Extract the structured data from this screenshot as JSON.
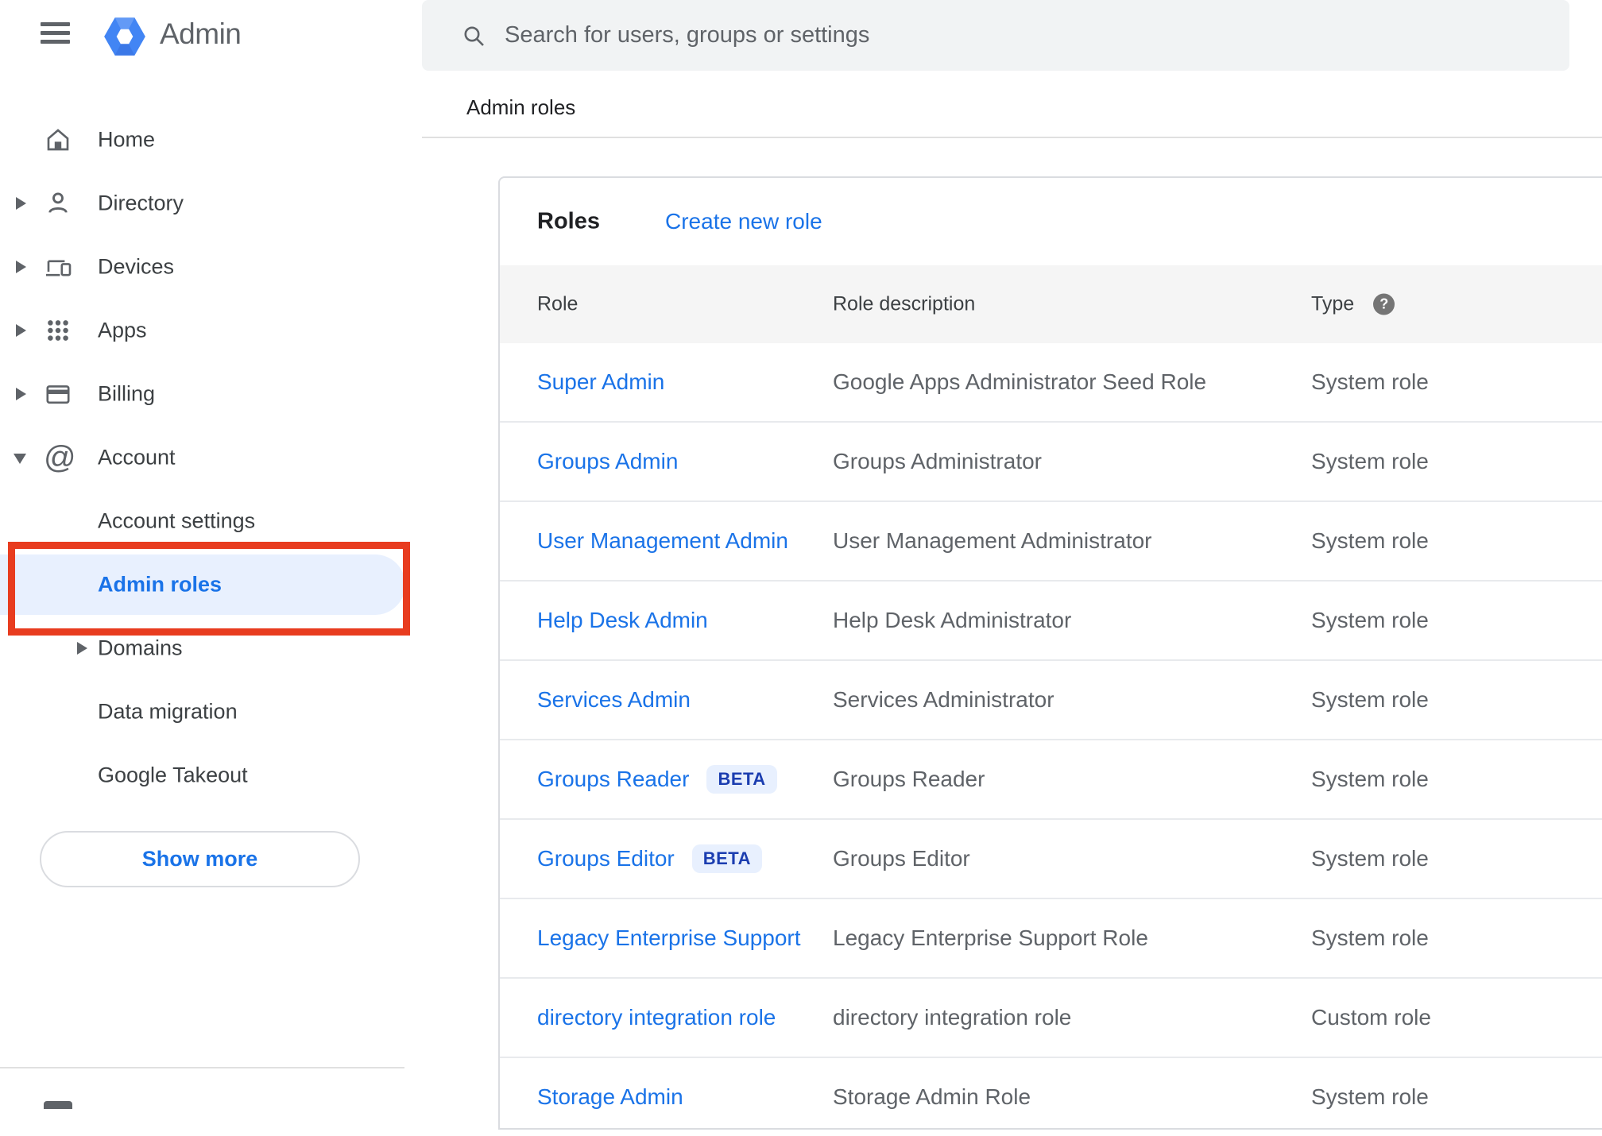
{
  "app": {
    "product_name": "Admin"
  },
  "search": {
    "placeholder": "Search for users, groups or settings"
  },
  "breadcrumb": "Admin roles",
  "sidebar": {
    "items": [
      {
        "label": "Home",
        "icon": "home-icon",
        "caret": "none",
        "indent": false,
        "active": false
      },
      {
        "label": "Directory",
        "icon": "person-icon",
        "caret": "right",
        "indent": false,
        "active": false
      },
      {
        "label": "Devices",
        "icon": "devices-icon",
        "caret": "right",
        "indent": false,
        "active": false
      },
      {
        "label": "Apps",
        "icon": "apps-grid-icon",
        "caret": "right",
        "indent": false,
        "active": false
      },
      {
        "label": "Billing",
        "icon": "credit-card-icon",
        "caret": "right",
        "indent": false,
        "active": false
      },
      {
        "label": "Account",
        "icon": "at-sign-icon",
        "caret": "down",
        "indent": false,
        "active": false
      },
      {
        "label": "Account settings",
        "icon": null,
        "caret": "none",
        "indent": true,
        "active": false
      },
      {
        "label": "Admin roles",
        "icon": null,
        "caret": "none",
        "indent": true,
        "active": true
      },
      {
        "label": "Domains",
        "icon": null,
        "caret": "right",
        "indent": true,
        "active": false
      },
      {
        "label": "Data migration",
        "icon": null,
        "caret": "none",
        "indent": true,
        "active": false
      },
      {
        "label": "Google Takeout",
        "icon": null,
        "caret": "none",
        "indent": true,
        "active": false
      }
    ],
    "show_more_label": "Show more"
  },
  "roles_panel": {
    "title": "Roles",
    "create_link_label": "Create new role",
    "columns": {
      "role": "Role",
      "description": "Role description",
      "type": "Type"
    },
    "help_icon_glyph": "?",
    "beta_label": "BETA",
    "rows": [
      {
        "role": "Super Admin",
        "beta": false,
        "description": "Google Apps Administrator Seed Role",
        "type": "System role"
      },
      {
        "role": "Groups Admin",
        "beta": false,
        "description": "Groups Administrator",
        "type": "System role"
      },
      {
        "role": "User Management Admin",
        "beta": false,
        "description": "User Management Administrator",
        "type": "System role"
      },
      {
        "role": "Help Desk Admin",
        "beta": false,
        "description": "Help Desk Administrator",
        "type": "System role"
      },
      {
        "role": "Services Admin",
        "beta": false,
        "description": "Services Administrator",
        "type": "System role"
      },
      {
        "role": "Groups Reader",
        "beta": true,
        "description": "Groups Reader",
        "type": "System role"
      },
      {
        "role": "Groups Editor",
        "beta": true,
        "description": "Groups Editor",
        "type": "System role"
      },
      {
        "role": "Legacy Enterprise Support",
        "beta": false,
        "description": "Legacy Enterprise Support Role",
        "type": "System role"
      },
      {
        "role": "directory integration role",
        "beta": false,
        "description": "directory integration role",
        "type": "Custom role"
      },
      {
        "role": "Storage Admin",
        "beta": false,
        "description": "Storage Admin Role",
        "type": "System role"
      }
    ]
  },
  "colors": {
    "accent_blue": "#1a73e8",
    "active_pill_bg": "#e8f0fe",
    "annotation_red": "#e83c1f",
    "beta_text": "#1b3db0",
    "beta_bg": "#e8f0fe",
    "search_bg": "#f1f3f4",
    "table_header_bg": "#f5f5f5",
    "border_gray": "#dadce0",
    "text_primary": "#202124",
    "text_secondary": "#5f6368",
    "logo_blue": "#4285f4"
  }
}
